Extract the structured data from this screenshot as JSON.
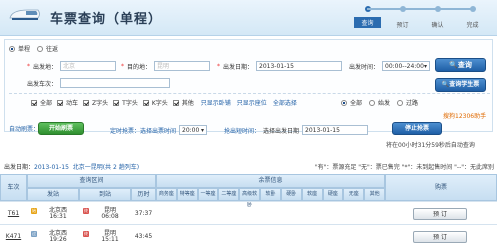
{
  "header": {
    "title": "车票查询（单程）",
    "steps": [
      {
        "label": "查询",
        "active": true
      },
      {
        "label": "预订",
        "active": false
      },
      {
        "label": "确认",
        "active": false
      },
      {
        "label": "完成",
        "active": false
      }
    ]
  },
  "trip": {
    "one_way": "单程",
    "round_trip": "往返"
  },
  "form": {
    "from_label": "出发地：",
    "from_ph": "北京",
    "to_label": "目的地：",
    "to_ph": "昆明",
    "date_label": "出发日期：",
    "date_value": "2013-01-15",
    "time_label": "出发时间：",
    "time_value": "00:00--24:00",
    "train_label": "出发车次：",
    "query_btn": "查询",
    "student_btn": "查询学生票"
  },
  "types": [
    {
      "label": "全部",
      "on": true
    },
    {
      "label": "动车",
      "on": true
    },
    {
      "label": "Z字头",
      "on": true
    },
    {
      "label": "T字头",
      "on": true
    },
    {
      "label": "K字头",
      "on": true
    },
    {
      "label": "其他",
      "on": true
    }
  ],
  "links": {
    "only_booking": "只显示卧铺",
    "only_seat": "只显示座位",
    "all_select": "全部选择"
  },
  "filter": [
    {
      "label": "全部",
      "on": true
    },
    {
      "label": "始发",
      "on": false
    },
    {
      "label": "过路",
      "on": false
    }
  ],
  "promo": "搜狗12306助手",
  "auto": {
    "label": "自动刷票：",
    "start_btn": "开始刷票",
    "timed_label": "定时抢票：选择出票时间",
    "timed_value": "20:00",
    "sel_label": "抢出短时间：",
    "sel_date_label": "选择出发日期",
    "sel_date_value": "2013-01-15",
    "stop_btn": "停止抢票",
    "note": "将在00小时31分59秒后自动查询"
  },
  "info": {
    "date_label": "出发日期：",
    "date": "2013-01-15",
    "route": "北京一昆明(共 2 趟列车)",
    "legend": "\"有\"：票源充足  \"无\"：票已售完  \"*\"：未到起售时间  \"--\"：无此席别"
  },
  "table": {
    "h_train": "车次",
    "h_section": "查询区间",
    "h_fare": "余票信息",
    "h_book": "购票",
    "h_from": "发站",
    "h_to": "到站",
    "h_dur": "历时",
    "seat_cols": [
      "商务座",
      "特等座",
      "一等座",
      "二等座",
      "高级软卧",
      "软卧",
      "硬卧",
      "软座",
      "硬座",
      "无座",
      "其他"
    ],
    "rows": [
      {
        "no": "T61",
        "from": "北京西",
        "dep": "16:31",
        "to": "昆明",
        "arr": "06:08",
        "dur": "37:37",
        "book": "预 订"
      },
      {
        "no": "K471",
        "from": "北京西",
        "dep": "19:26",
        "to": "昆明",
        "arr": "15:11",
        "dur": "43:45",
        "book": "预 订"
      }
    ]
  }
}
